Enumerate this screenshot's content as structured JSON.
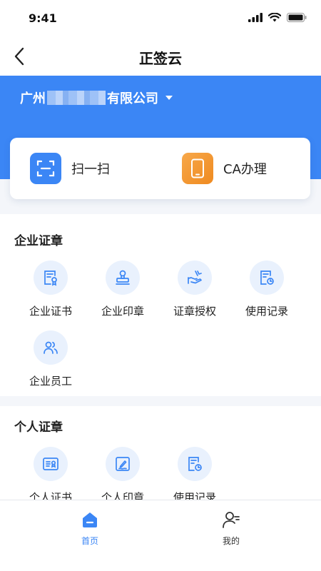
{
  "status": {
    "time": "9:41"
  },
  "nav": {
    "title": "正签云"
  },
  "company": {
    "prefix": "广州",
    "suffix": "有限公司"
  },
  "actions": [
    {
      "label": "扫一扫",
      "icon": "scan-icon",
      "color": "#3b86f5"
    },
    {
      "label": "CA办理",
      "icon": "phone-icon",
      "color": "#f29632"
    }
  ],
  "enterprise": {
    "title": "企业证章",
    "items": [
      {
        "label": "企业证书",
        "icon": "certificate-icon"
      },
      {
        "label": "企业印章",
        "icon": "seal-icon"
      },
      {
        "label": "证章授权",
        "icon": "authorize-icon"
      },
      {
        "label": "使用记录",
        "icon": "record-icon"
      },
      {
        "label": "企业员工",
        "icon": "employees-icon"
      }
    ]
  },
  "personal": {
    "title": "个人证章",
    "items": [
      {
        "label": "个人证书",
        "icon": "id-card-icon"
      },
      {
        "label": "个人印章",
        "icon": "signature-icon"
      },
      {
        "label": "使用记录",
        "icon": "record-icon"
      }
    ]
  },
  "tabs": [
    {
      "label": "首页",
      "icon": "home-icon",
      "active": true
    },
    {
      "label": "我的",
      "icon": "user-icon",
      "active": false
    }
  ],
  "colors": {
    "primary": "#3b86f5",
    "iconBg": "#e9f1fd",
    "orange": "#f29632"
  }
}
